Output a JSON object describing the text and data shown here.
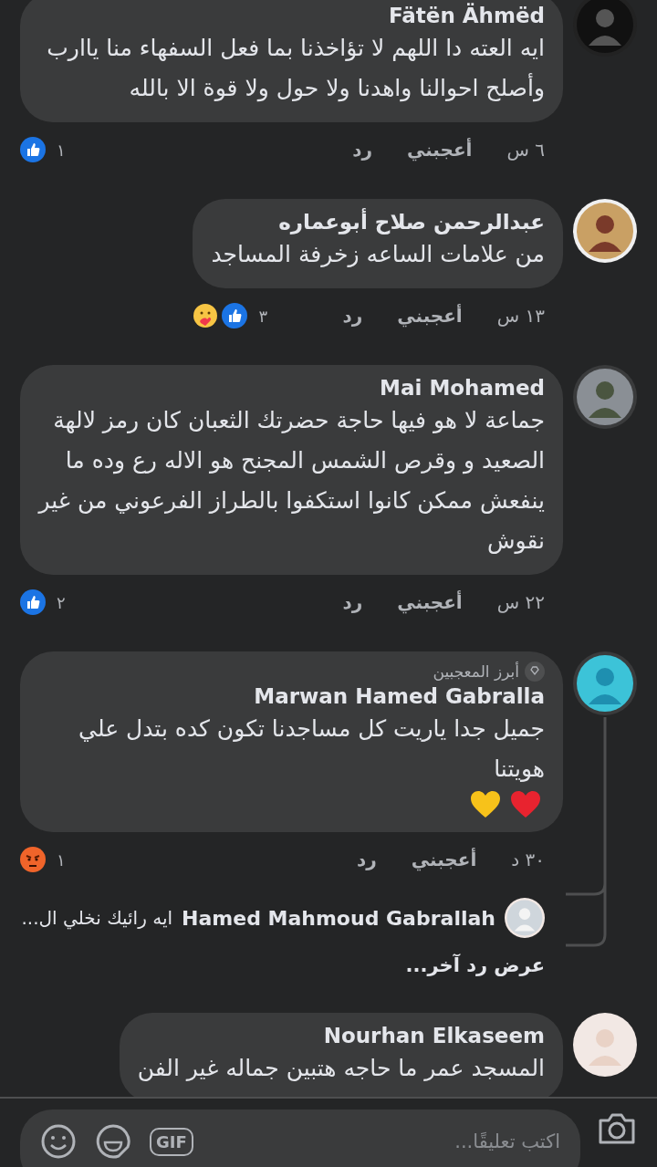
{
  "comments": [
    {
      "author": "Fätën Ähmëd",
      "text": "ايه العته دا اللهم لا تؤاخذنا بما فعل السفهاء منا ياارب وأصلح احوالنا واهدنا ولا حول ولا قوة الا بالله",
      "time": "٦ س",
      "like_label": "أعجبني",
      "reply_label": "رد",
      "reaction_count": "١",
      "reactions": [
        {
          "kind": "like"
        }
      ]
    },
    {
      "author": "عبدالرحمن صلاح أبوعماره",
      "text": "من علامات الساعه زخرفة المساجد",
      "time": "١٣ س",
      "like_label": "أعجبني",
      "reply_label": "رد",
      "reaction_count": "٣",
      "reactions": [
        {
          "kind": "like"
        },
        {
          "kind": "care"
        }
      ]
    },
    {
      "author": "Mai Mohamed",
      "text": "جماعة لا هو فيها حاجة حضرتك الثعبان كان رمز لالهة الصعيد و وقرص الشمس المجنح هو الاله رع وده ما ينفعش ممكن كانوا استكفوا بالطراز الفرعوني من غير نقوش",
      "time": "٢٢ س",
      "like_label": "أعجبني",
      "reply_label": "رد",
      "reaction_count": "٢",
      "reactions": [
        {
          "kind": "like"
        }
      ]
    },
    {
      "author": "Marwan Hamed Gabralla",
      "badge": "أبرز المعجبين",
      "text": "جميل جدا ياريت كل مساجدنا تكون كده بتدل علي هويتنا",
      "emojis": [
        {
          "kind": "red_heart"
        },
        {
          "kind": "yellow_heart"
        }
      ],
      "time": "٣٠ د",
      "like_label": "أعجبني",
      "reply_label": "رد",
      "reaction_count": "١",
      "reactions": [
        {
          "kind": "angry"
        }
      ],
      "replies": [
        {
          "author": "Hamed Mahmoud Gabrallah",
          "text": "ايه رائيك نخلي ال..."
        }
      ],
      "more_replies": "عرض رد آخر..."
    },
    {
      "author": "Nourhan Elkaseem",
      "text": "المسجد عمر ما حاجه هتبين جماله غير الفن"
    }
  ],
  "composer": {
    "placeholder": "اكتب تعليقًا...",
    "gif_label": "GIF"
  }
}
